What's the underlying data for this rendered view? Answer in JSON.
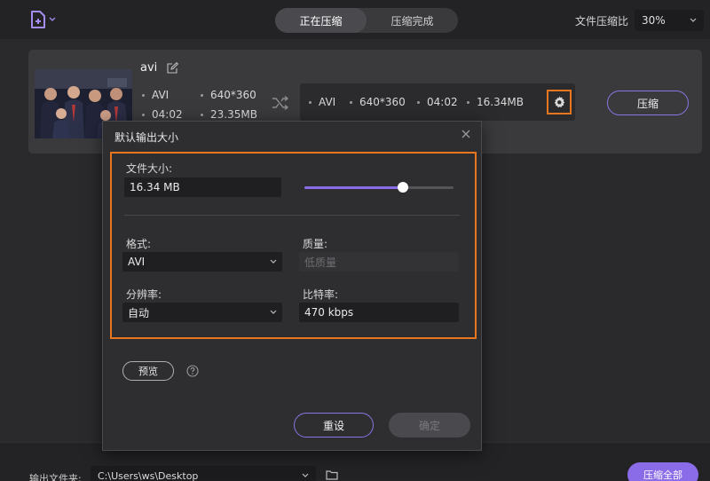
{
  "header": {
    "tabs": [
      {
        "label": "正在压缩",
        "active": true
      },
      {
        "label": "压缩完成",
        "active": false
      }
    ],
    "ratio_label": "文件压缩比",
    "ratio_value": "30%"
  },
  "file": {
    "name": "avi",
    "source": {
      "format": "AVI",
      "resolution": "640*360",
      "duration": "04:02",
      "size": "23.35MB"
    },
    "output": {
      "format": "AVI",
      "resolution": "640*360",
      "duration": "04:02",
      "size": "16.34MB"
    },
    "compress_label": "压缩"
  },
  "dialog": {
    "title": "默认输出大小",
    "file_size_label": "文件大小:",
    "file_size_value": "16.34 MB",
    "slider_level": 0.66,
    "format_label": "格式:",
    "format_value": "AVI",
    "quality_label": "质量:",
    "quality_value": "低质量",
    "resolution_label": "分辨率:",
    "resolution_value": "自动",
    "bitrate_label": "比特率:",
    "bitrate_value": "470 kbps",
    "preview_label": "预览",
    "reset_label": "重设",
    "ok_label": "确定"
  },
  "footer": {
    "output_folder_label": "输出文件夹:",
    "output_folder_path": "C:\\Users\\ws\\Desktop",
    "compress_all_label": "压缩全部"
  },
  "colors": {
    "accent": "#8b6ce8",
    "highlight": "#e8761e"
  },
  "icons": {
    "add_file": "add-file-icon",
    "edit": "edit-icon",
    "shuffle": "shuffle-icon",
    "gear": "gear-icon",
    "close": "close-icon",
    "help": "help-icon",
    "folder": "folder-icon"
  }
}
